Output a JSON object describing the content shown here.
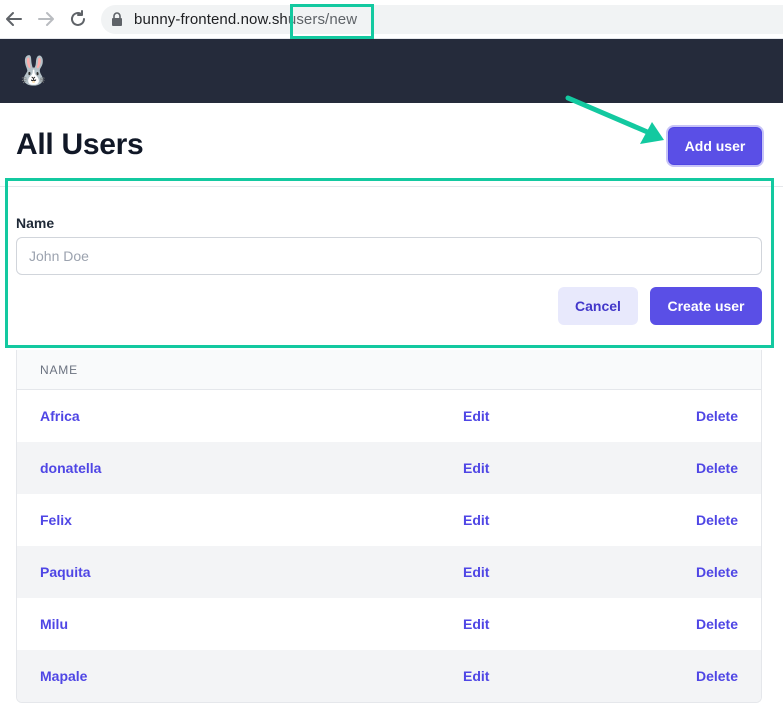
{
  "browser": {
    "url_host": "bunny-frontend.now.sh",
    "url_path": "users/new"
  },
  "app": {
    "logo_emoji": "🐰"
  },
  "page": {
    "title": "All Users",
    "add_button": "Add user"
  },
  "form": {
    "name_label": "Name",
    "name_placeholder": "John Doe",
    "name_value": "",
    "cancel_label": "Cancel",
    "create_label": "Create user"
  },
  "table": {
    "header_name": "NAME",
    "rows": [
      {
        "name": "Africa",
        "edit": "Edit",
        "delete": "Delete"
      },
      {
        "name": "donatella",
        "edit": "Edit",
        "delete": "Delete"
      },
      {
        "name": "Felix",
        "edit": "Edit",
        "delete": "Delete"
      },
      {
        "name": "Paquita",
        "edit": "Edit",
        "delete": "Delete"
      },
      {
        "name": "Milu",
        "edit": "Edit",
        "delete": "Delete"
      },
      {
        "name": "Mapale",
        "edit": "Edit",
        "delete": "Delete"
      }
    ]
  },
  "colors": {
    "accent": "#5a4fe6",
    "highlight": "#13c9a0",
    "header_bg": "#252b3b"
  }
}
